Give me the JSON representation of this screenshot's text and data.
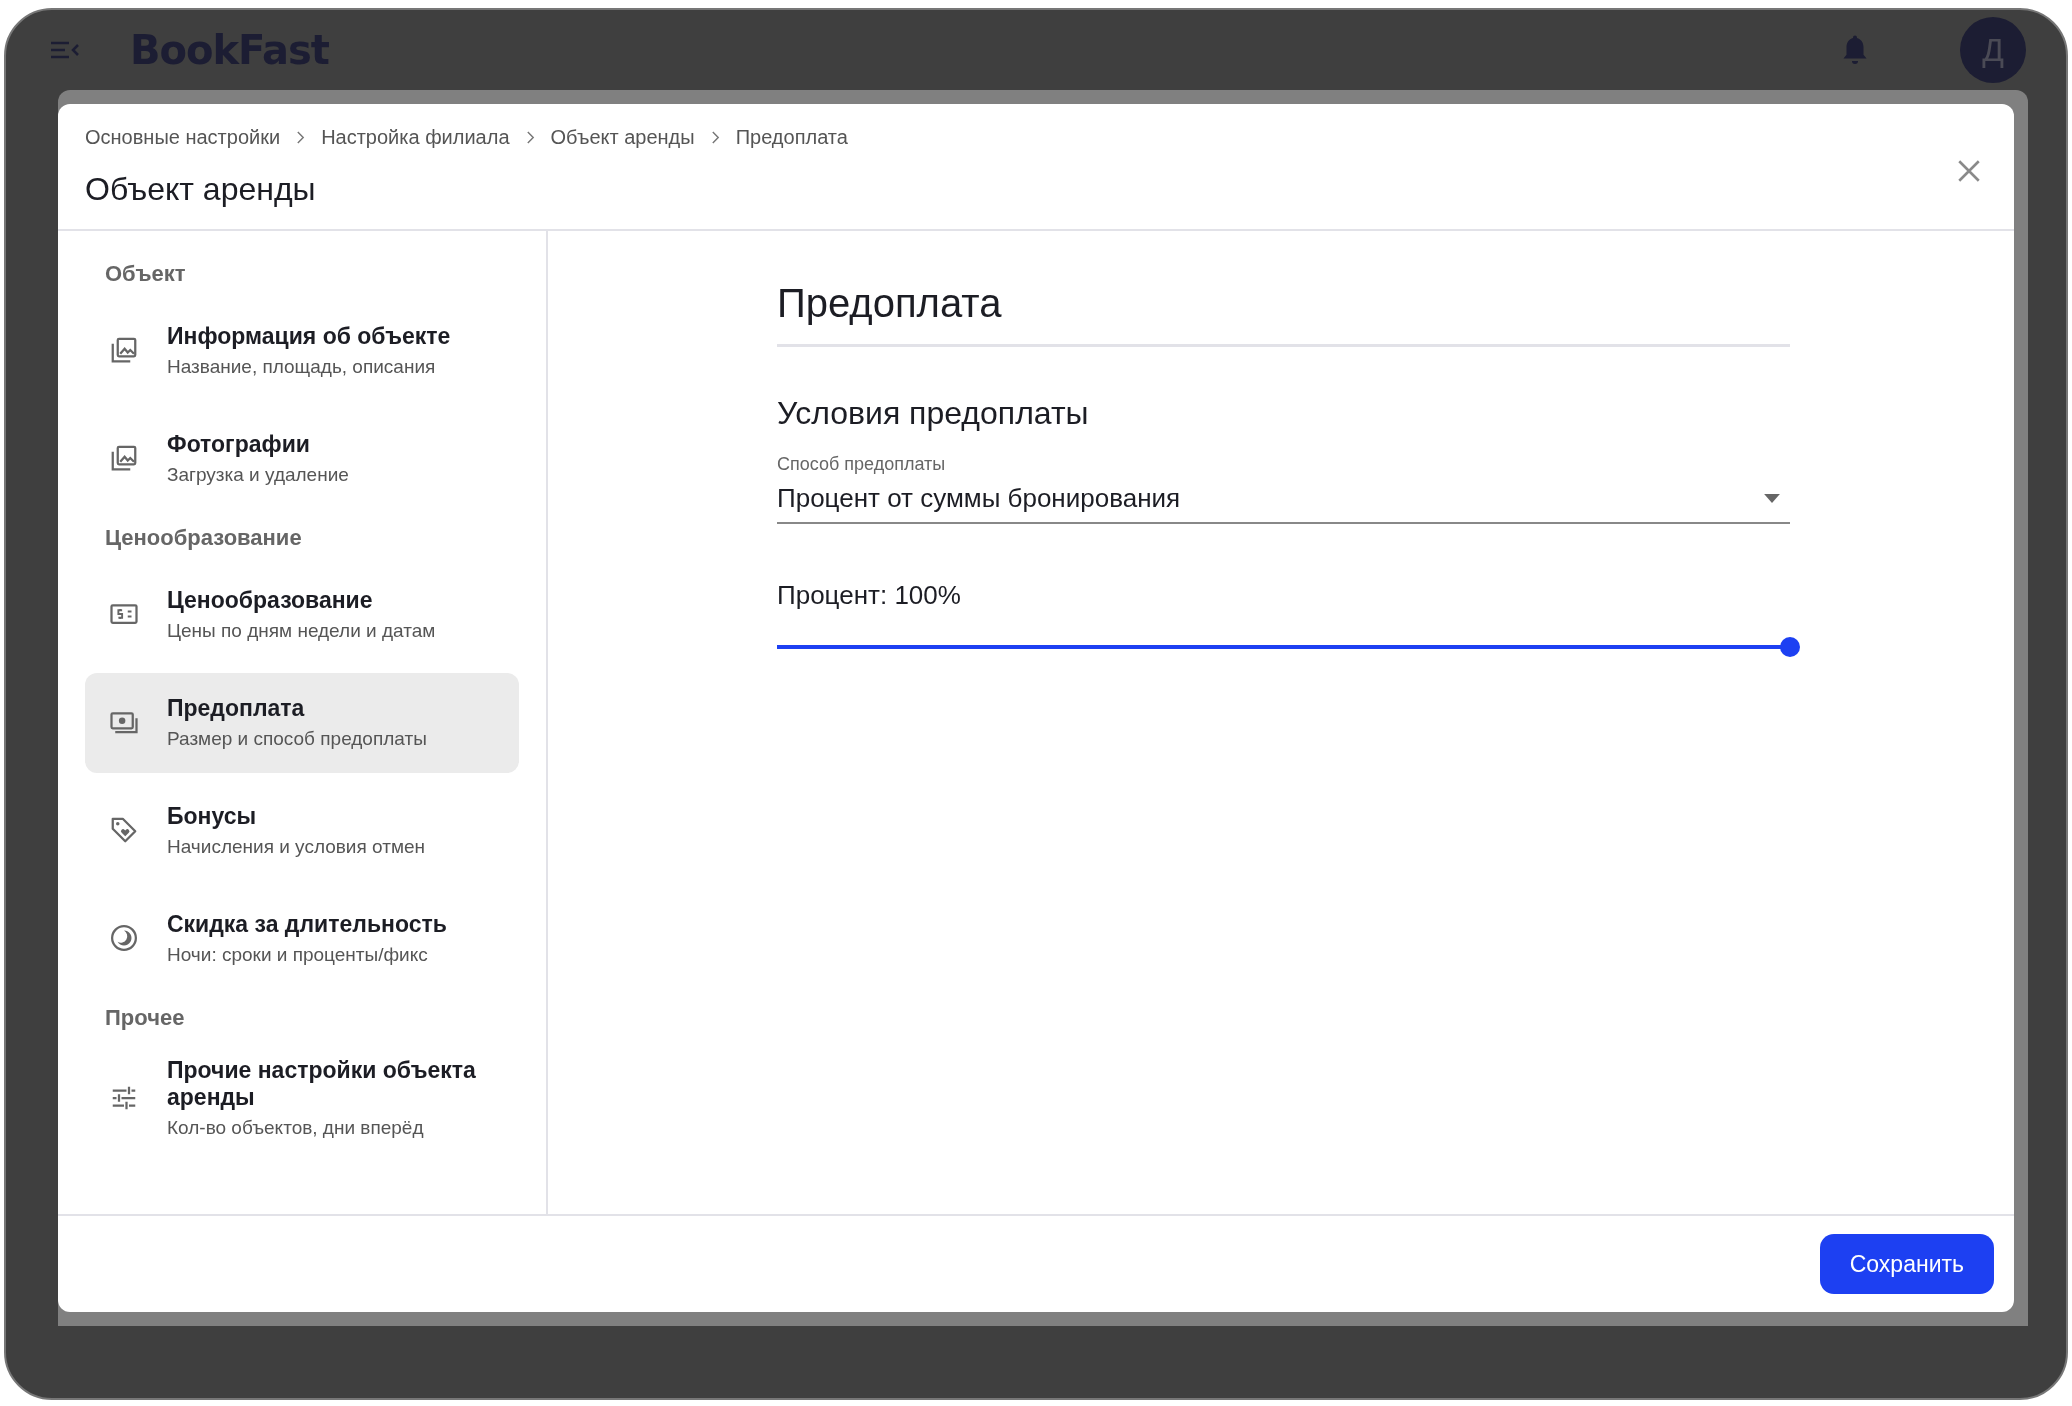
{
  "app_bar": {
    "logo": "BookFast",
    "avatar": "Д"
  },
  "dialog": {
    "breadcrumbs": [
      "Основные настройки",
      "Настройка филиала",
      "Объект аренды",
      "Предоплата"
    ],
    "title": "Объект аренды",
    "nav": [
      {
        "heading": "Объект",
        "items": [
          {
            "kind": "photos",
            "title": "Информация об объекте",
            "subtitle": "Название, площадь, описания",
            "selected": false
          },
          {
            "kind": "photos",
            "title": "Фотографии",
            "subtitle": "Загрузка и удаление",
            "selected": false
          }
        ]
      },
      {
        "heading": "Ценообразование",
        "items": [
          {
            "kind": "pricing",
            "title": "Ценообразование",
            "subtitle": "Цены по дням недели и датам",
            "selected": false
          },
          {
            "kind": "prepayment",
            "title": "Предоплата",
            "subtitle": "Размер и способ предоплаты",
            "selected": true
          },
          {
            "kind": "bonus",
            "title": "Бонусы",
            "subtitle": "Начисления и условия отмен",
            "selected": false
          },
          {
            "kind": "discount",
            "title": "Скидка за длительность",
            "subtitle": "Ночи: сроки и проценты/фикс",
            "selected": false
          }
        ]
      },
      {
        "heading": "Прочее",
        "items": [
          {
            "kind": "settings",
            "title": "Прочие настройки объекта аренды",
            "subtitle": "Кол-во объектов, дни вперёд",
            "selected": false
          }
        ]
      }
    ],
    "content": {
      "title": "Предоплата",
      "section": "Условия предоплаты",
      "select": {
        "label": "Способ предоплаты",
        "value": "Процент от суммы бронирования"
      },
      "slider": {
        "label": "Процент: 100%",
        "level": 1
      }
    },
    "save_button": "Сохранить"
  }
}
